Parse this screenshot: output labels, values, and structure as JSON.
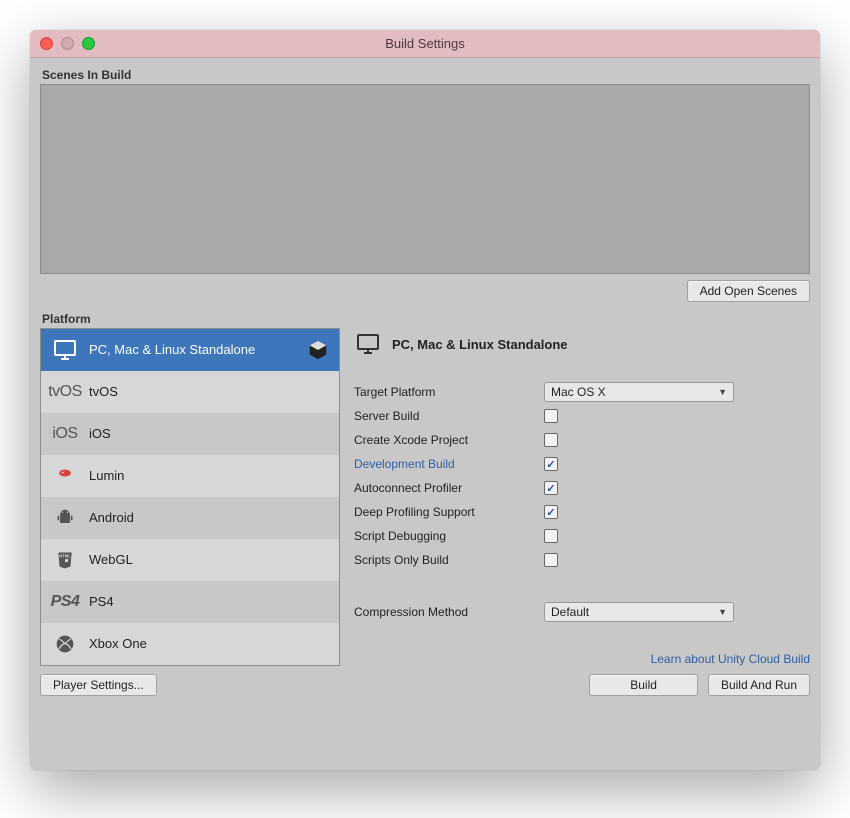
{
  "window": {
    "title": "Build Settings"
  },
  "scenes": {
    "label": "Scenes In Build"
  },
  "buttons": {
    "add_open_scenes": "Add Open Scenes",
    "player_settings": "Player Settings...",
    "build": "Build",
    "build_and_run": "Build And Run"
  },
  "platforms": {
    "label": "Platform",
    "items": [
      {
        "name": "PC, Mac & Linux Standalone",
        "selected": true,
        "icon": "monitor"
      },
      {
        "name": "tvOS",
        "selected": false,
        "icon": "tvos-text"
      },
      {
        "name": "iOS",
        "selected": false,
        "icon": "ios-text"
      },
      {
        "name": "Lumin",
        "selected": false,
        "icon": "lumin"
      },
      {
        "name": "Android",
        "selected": false,
        "icon": "android"
      },
      {
        "name": "WebGL",
        "selected": false,
        "icon": "html5"
      },
      {
        "name": "PS4",
        "selected": false,
        "icon": "ps4-text"
      },
      {
        "name": "Xbox One",
        "selected": false,
        "icon": "xbox"
      }
    ]
  },
  "details": {
    "title": "PC, Mac & Linux Standalone",
    "target_platform": {
      "label": "Target Platform",
      "value": "Mac OS X"
    },
    "server_build": {
      "label": "Server Build",
      "checked": false
    },
    "create_xcode": {
      "label": "Create Xcode Project",
      "checked": false
    },
    "dev_build": {
      "label": "Development Build",
      "checked": true
    },
    "autoconnect_profiler": {
      "label": "Autoconnect Profiler",
      "checked": true
    },
    "deep_profiling": {
      "label": "Deep Profiling Support",
      "checked": true
    },
    "script_debugging": {
      "label": "Script Debugging",
      "checked": false
    },
    "scripts_only": {
      "label": "Scripts Only Build",
      "checked": false
    },
    "compression": {
      "label": "Compression Method",
      "value": "Default"
    }
  },
  "link": {
    "cloud_build": "Learn about Unity Cloud Build"
  }
}
